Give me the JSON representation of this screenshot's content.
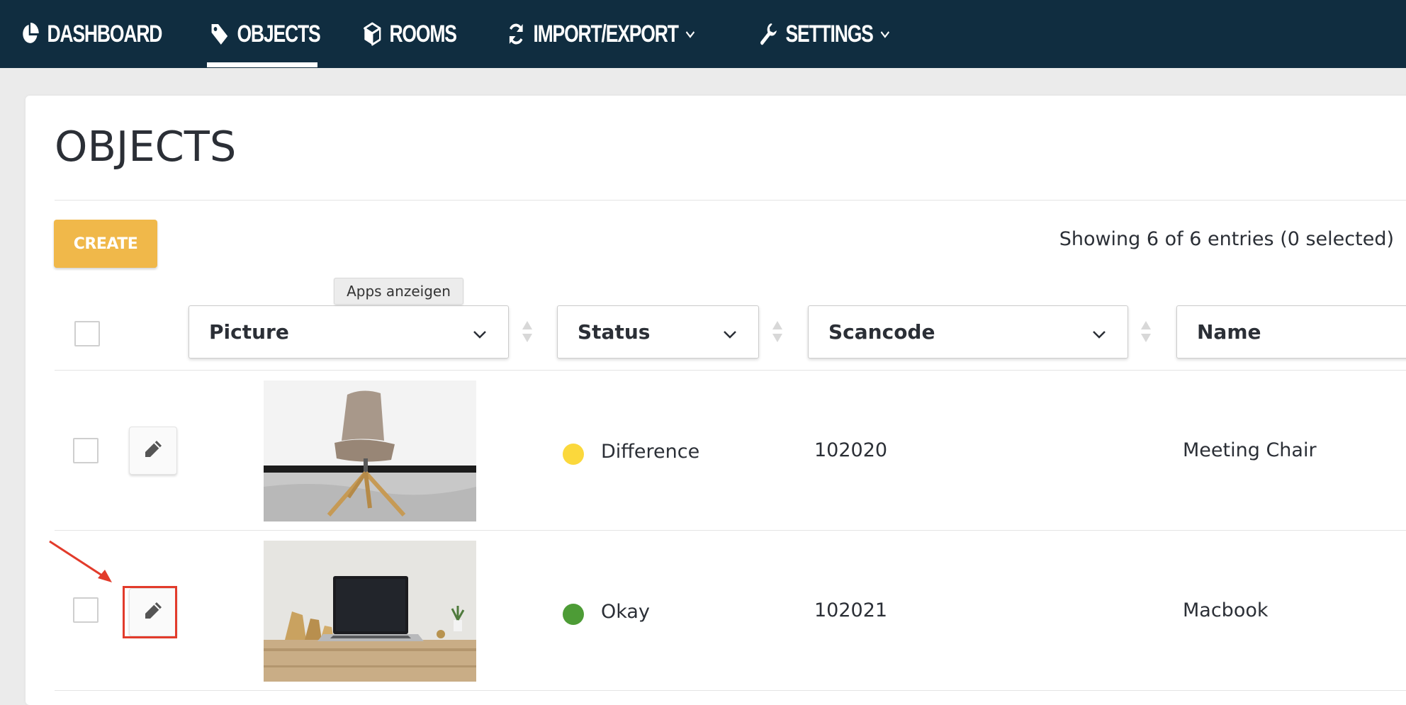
{
  "nav": {
    "items": [
      {
        "label": "DASHBOARD",
        "icon": "pie-chart-icon"
      },
      {
        "label": "OBJECTS",
        "icon": "tag-icon",
        "active": true
      },
      {
        "label": "ROOMS",
        "icon": "cube-icon"
      },
      {
        "label": "IMPORT/EXPORT",
        "icon": "refresh-icon",
        "dropdown": true
      },
      {
        "label": "SETTINGS",
        "icon": "wrench-icon",
        "dropdown": true
      }
    ]
  },
  "colors": {
    "nav_bg": "#102d40",
    "accent": "#f0b84a",
    "status_difference": "#fbd83c",
    "status_okay": "#4d9c36",
    "highlight": "#e23b2b"
  },
  "page": {
    "title": "OBJECTS",
    "create_label": "CREATE",
    "showing": "Showing 6 of 6 entries (0 selected)",
    "tooltip": "Apps anzeigen"
  },
  "table": {
    "columns": [
      "Picture",
      "Status",
      "Scancode",
      "Name"
    ],
    "rows": [
      {
        "picture": "meeting-chair-photo",
        "status": "Difference",
        "scancode": "102020",
        "name": "Meeting Chair"
      },
      {
        "picture": "macbook-photo",
        "status": "Okay",
        "scancode": "102021",
        "name": "Macbook"
      }
    ]
  }
}
